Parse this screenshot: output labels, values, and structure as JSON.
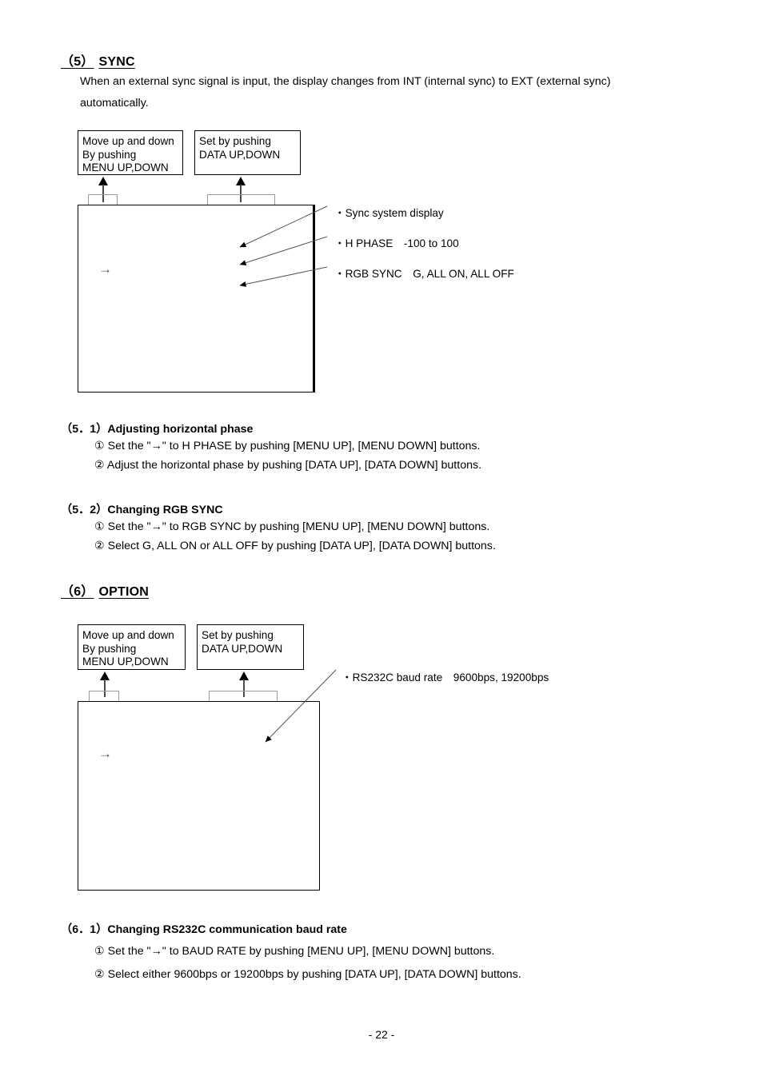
{
  "page": {
    "footer": "- 22 -"
  },
  "section5": {
    "heading_num": "（5）",
    "heading_title": "SYNC",
    "intro_line1": "When an external sync signal is input, the display changes from INT (internal sync) to EXT (external sync)",
    "intro_line2": "automatically.",
    "callout_menu": {
      "line1": "Move up and down",
      "line2": "By pushing",
      "line3": "MENU UP,DOWN"
    },
    "callout_data": {
      "line1": "Set by pushing",
      "line2": "DATA UP,DOWN"
    },
    "display_cursor": "→",
    "annotations": [
      "・Sync system display",
      "・H PHASE　-100 to 100",
      "・RGB SYNC　G, ALL ON, ALL OFF"
    ],
    "sub1": {
      "heading": "（5．1）Adjusting horizontal phase",
      "step1": "① Set the \"→\" to H PHASE by pushing [MENU UP], [MENU DOWN] buttons.",
      "step2": "② Adjust the horizontal phase by pushing [DATA UP], [DATA DOWN] buttons."
    },
    "sub2": {
      "heading": "（5．2）Changing RGB SYNC",
      "step1": "① Set the \"→\" to RGB SYNC by pushing [MENU UP], [MENU DOWN] buttons.",
      "step2": "② Select G, ALL ON or ALL OFF by pushing [DATA UP], [DATA DOWN] buttons."
    }
  },
  "section6": {
    "heading_num": "（6）",
    "heading_title": "OPTION",
    "callout_menu": {
      "line1": "Move up and down",
      "line2": "By pushing",
      "line3": "MENU UP,DOWN"
    },
    "callout_data": {
      "line1": "Set by pushing",
      "line2": "DATA UP,DOWN"
    },
    "display_cursor": "→",
    "annotations": [
      "・RS232C baud rate　9600bps, 19200bps"
    ],
    "sub1": {
      "heading": "（6．1）Changing RS232C communication baud rate",
      "step1": "① Set the \"→\" to BAUD RATE by pushing [MENU UP], [MENU DOWN] buttons.",
      "step2": "② Select either 9600bps or 19200bps by pushing [DATA UP], [DATA DOWN] buttons."
    }
  }
}
